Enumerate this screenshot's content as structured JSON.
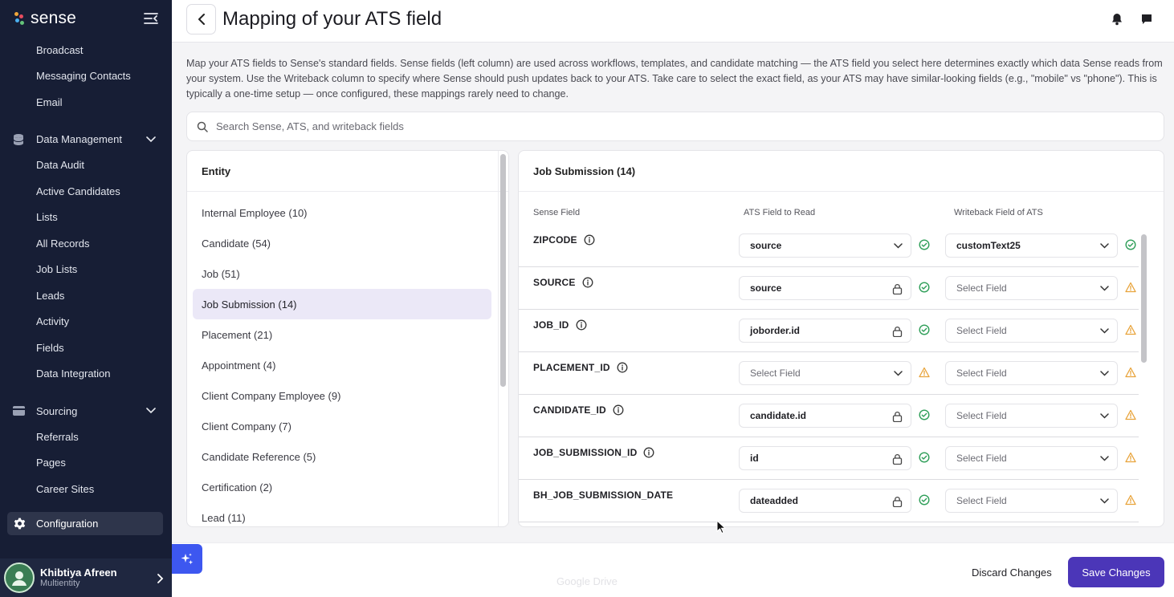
{
  "brand": {
    "name": "sense"
  },
  "sidebar": {
    "top_items": [
      "Broadcast",
      "Messaging Contacts",
      "Email"
    ],
    "groups": [
      {
        "label": "Data Management",
        "icon": "database-icon",
        "items": [
          "Data Audit",
          "Active Candidates",
          "Lists",
          "All Records",
          "Job Lists",
          "Leads",
          "Activity",
          "Fields",
          "Data Integration"
        ]
      },
      {
        "label": "Sourcing",
        "icon": "card-icon",
        "items": [
          "Referrals",
          "Pages",
          "Career Sites"
        ]
      }
    ],
    "configuration": "Configuration",
    "user": {
      "name": "Khibtiya Afreen",
      "subtitle": "Multientity"
    }
  },
  "header": {
    "title": "Mapping of your ATS field"
  },
  "description": "Map your ATS fields to Sense's standard fields. Sense fields (left column) are used across workflows, templates, and candidate matching — the ATS field you select here determines exactly which data Sense reads from your system. Use the Writeback column to specify where Sense should push updates back to your ATS. Take care to select the exact field, as your ATS may have similar-looking fields (e.g., \"mobile\" vs \"phone\"). This is typically a one-time setup — once configured, these mappings rarely need to change.",
  "search": {
    "placeholder": "Search Sense, ATS, and writeback fields"
  },
  "entity_panel": {
    "title": "Entity",
    "items": [
      "Internal Employee (10)",
      "Candidate (54)",
      "Job (51)",
      "Job Submission (14)",
      "Placement (21)",
      "Appointment (4)",
      "Client Company Employee (9)",
      "Client Company (7)",
      "Candidate Reference (5)",
      "Certification (2)",
      "Lead (11)"
    ],
    "active_index": 3
  },
  "mapping": {
    "title": "Job Submission (14)",
    "columns": {
      "sense": "Sense Field",
      "ats": "ATS Field to Read",
      "writeback": "Writeback Field of ATS"
    },
    "rows": [
      {
        "field": "ZIPCODE",
        "info": true,
        "ats": "source",
        "ats_mode": "dropdown",
        "ats_status": "ok",
        "wb": "customText25",
        "wb_placeholder": false,
        "wb_status": "ok"
      },
      {
        "field": "SOURCE",
        "info": true,
        "ats": "source",
        "ats_mode": "locked",
        "ats_status": "ok",
        "wb": "Select Field",
        "wb_placeholder": true,
        "wb_status": "warn"
      },
      {
        "field": "JOB_ID",
        "info": true,
        "ats": "joborder.id",
        "ats_mode": "locked",
        "ats_status": "ok",
        "wb": "Select Field",
        "wb_placeholder": true,
        "wb_status": "warn"
      },
      {
        "field": "PLACEMENT_ID",
        "info": true,
        "ats": "Select Field",
        "ats_mode": "dropdown-placeholder",
        "ats_status": "warn",
        "wb": "Select Field",
        "wb_placeholder": true,
        "wb_status": "warn"
      },
      {
        "field": "CANDIDATE_ID",
        "info": true,
        "ats": "candidate.id",
        "ats_mode": "locked",
        "ats_status": "ok",
        "wb": "Select Field",
        "wb_placeholder": true,
        "wb_status": "warn"
      },
      {
        "field": "JOB_SUBMISSION_ID",
        "info": true,
        "ats": "id",
        "ats_mode": "locked",
        "ats_status": "ok",
        "wb": "Select Field",
        "wb_placeholder": true,
        "wb_status": "warn"
      },
      {
        "field": "BH_JOB_SUBMISSION_DATE",
        "info": false,
        "ats": "dateadded",
        "ats_mode": "locked",
        "ats_status": "ok",
        "wb": "Select Field",
        "wb_placeholder": true,
        "wb_status": "warn"
      }
    ]
  },
  "footer": {
    "discard": "Discard Changes",
    "save": "Save Changes",
    "ghost_text": "Google Drive"
  },
  "colors": {
    "sidebar_bg": "#171e35",
    "accent": "#4b36b8",
    "ok": "#2e9e58",
    "warn": "#e8a33a",
    "active_bg": "#ebe8f7"
  }
}
